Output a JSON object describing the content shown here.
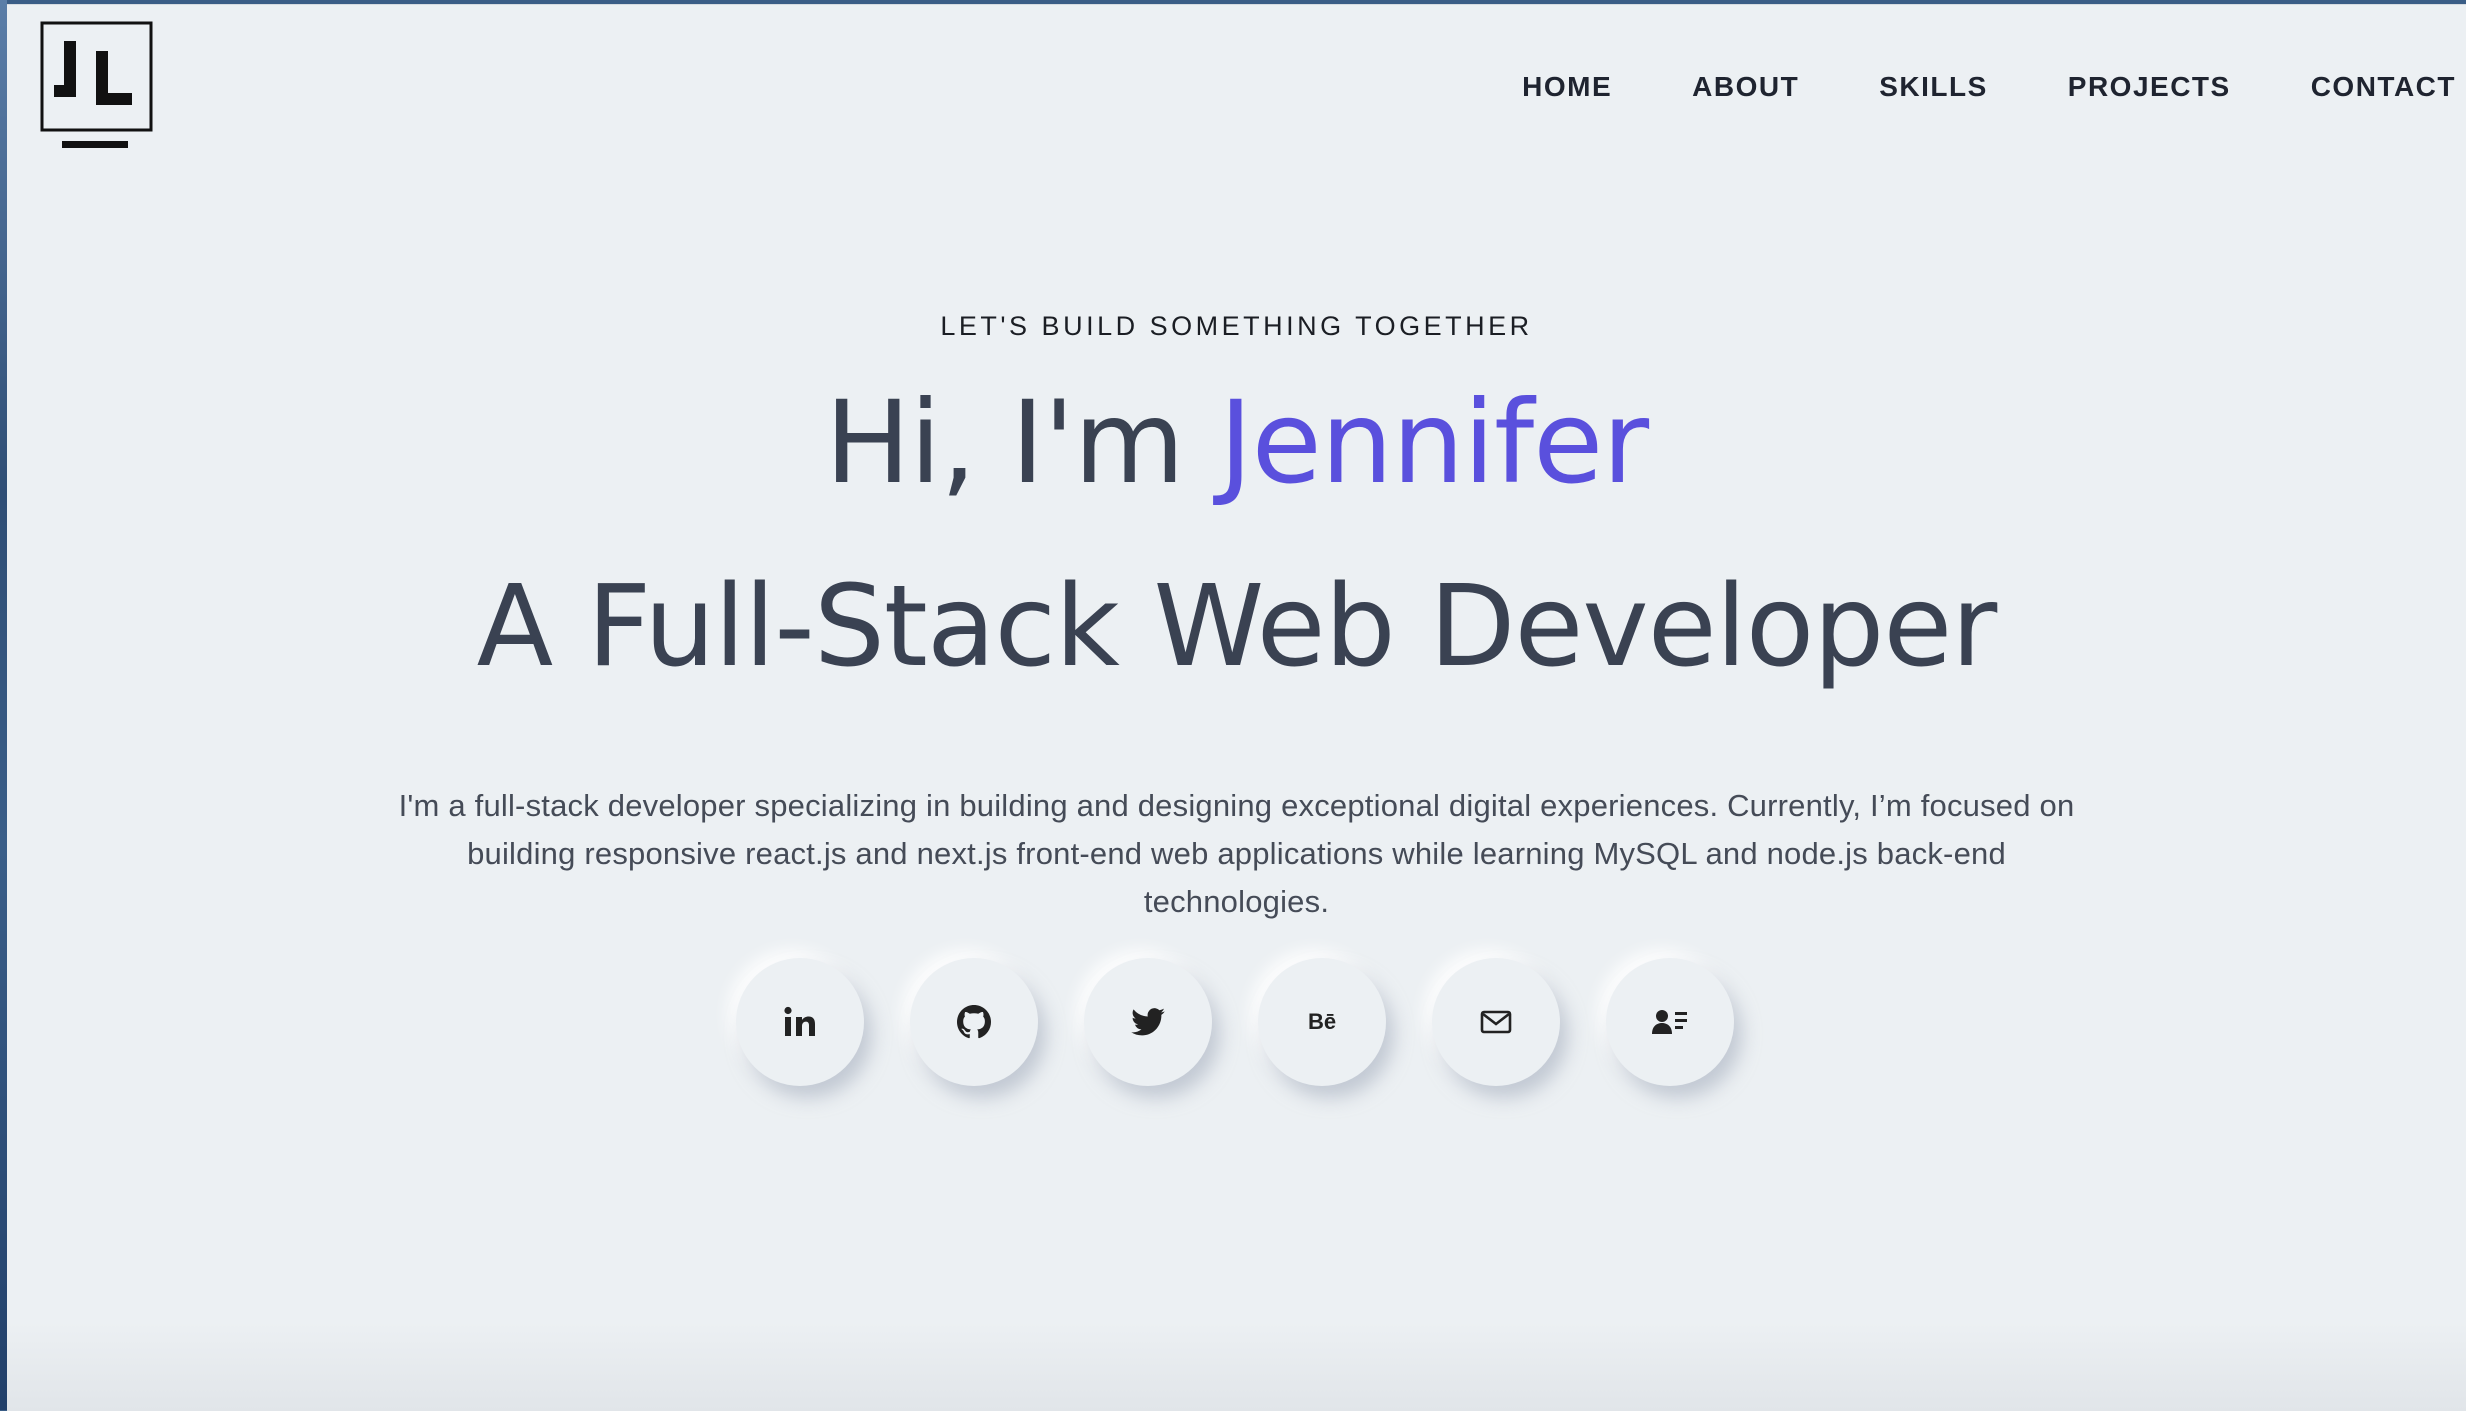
{
  "header": {
    "logo_text": "JL",
    "nav": [
      "HOME",
      "ABOUT",
      "SKILLS",
      "PROJECTS",
      "CONTACT"
    ]
  },
  "hero": {
    "eyebrow": "LET'S BUILD SOMETHING TOGETHER",
    "greeting": "Hi, I'm ",
    "name": "Jennifer",
    "role": "A Full-Stack Web Developer",
    "description": "I'm a full-stack developer specializing in building and designing exceptional digital experiences. Currently, I’m focused on building responsive react.js and next.js front-end web applications while learning MySQL and node.js back-end technologies."
  },
  "socials": [
    {
      "icon": "linkedin-icon"
    },
    {
      "icon": "github-icon"
    },
    {
      "icon": "twitter-icon"
    },
    {
      "icon": "behance-icon",
      "glyph": "Bē"
    },
    {
      "icon": "mail-icon"
    },
    {
      "icon": "resume-icon"
    }
  ],
  "colors": {
    "background": "#ecf0f3",
    "accent": "#5a50dd",
    "heading": "#3a4252"
  }
}
